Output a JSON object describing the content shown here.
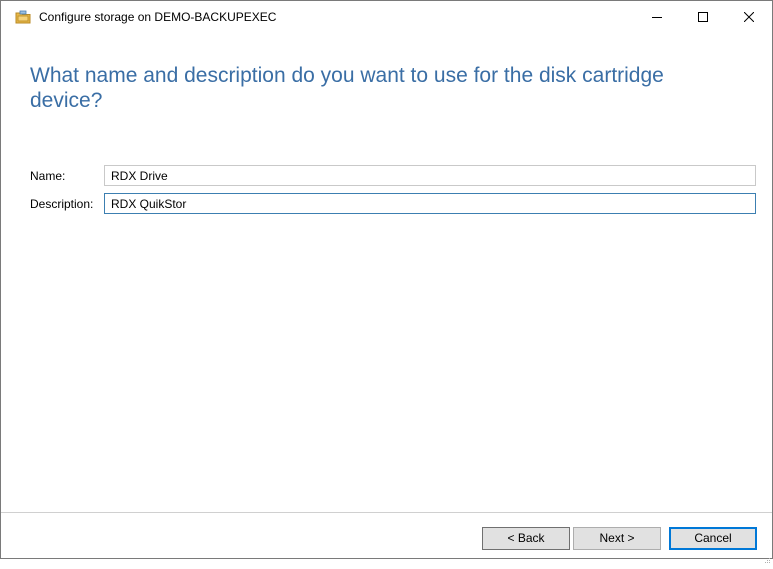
{
  "window": {
    "title": "Configure storage on DEMO-BACKUPEXEC",
    "icon": "storage-folder-icon",
    "controls": {
      "minimize_icon": "minimize-icon",
      "maximize_icon": "maximize-icon",
      "close_icon": "close-icon"
    }
  },
  "page": {
    "heading": "What name and description do you want to use for the disk cartridge device?",
    "heading_color": "#3a6ea5"
  },
  "form": {
    "name_label": "Name:",
    "name_value": "RDX Drive",
    "description_label": "Description:",
    "description_value": "RDX QuikStor"
  },
  "footer": {
    "back_label": "< Back",
    "next_label": "Next >",
    "cancel_label": "Cancel",
    "focus_color": "#0078d7"
  }
}
